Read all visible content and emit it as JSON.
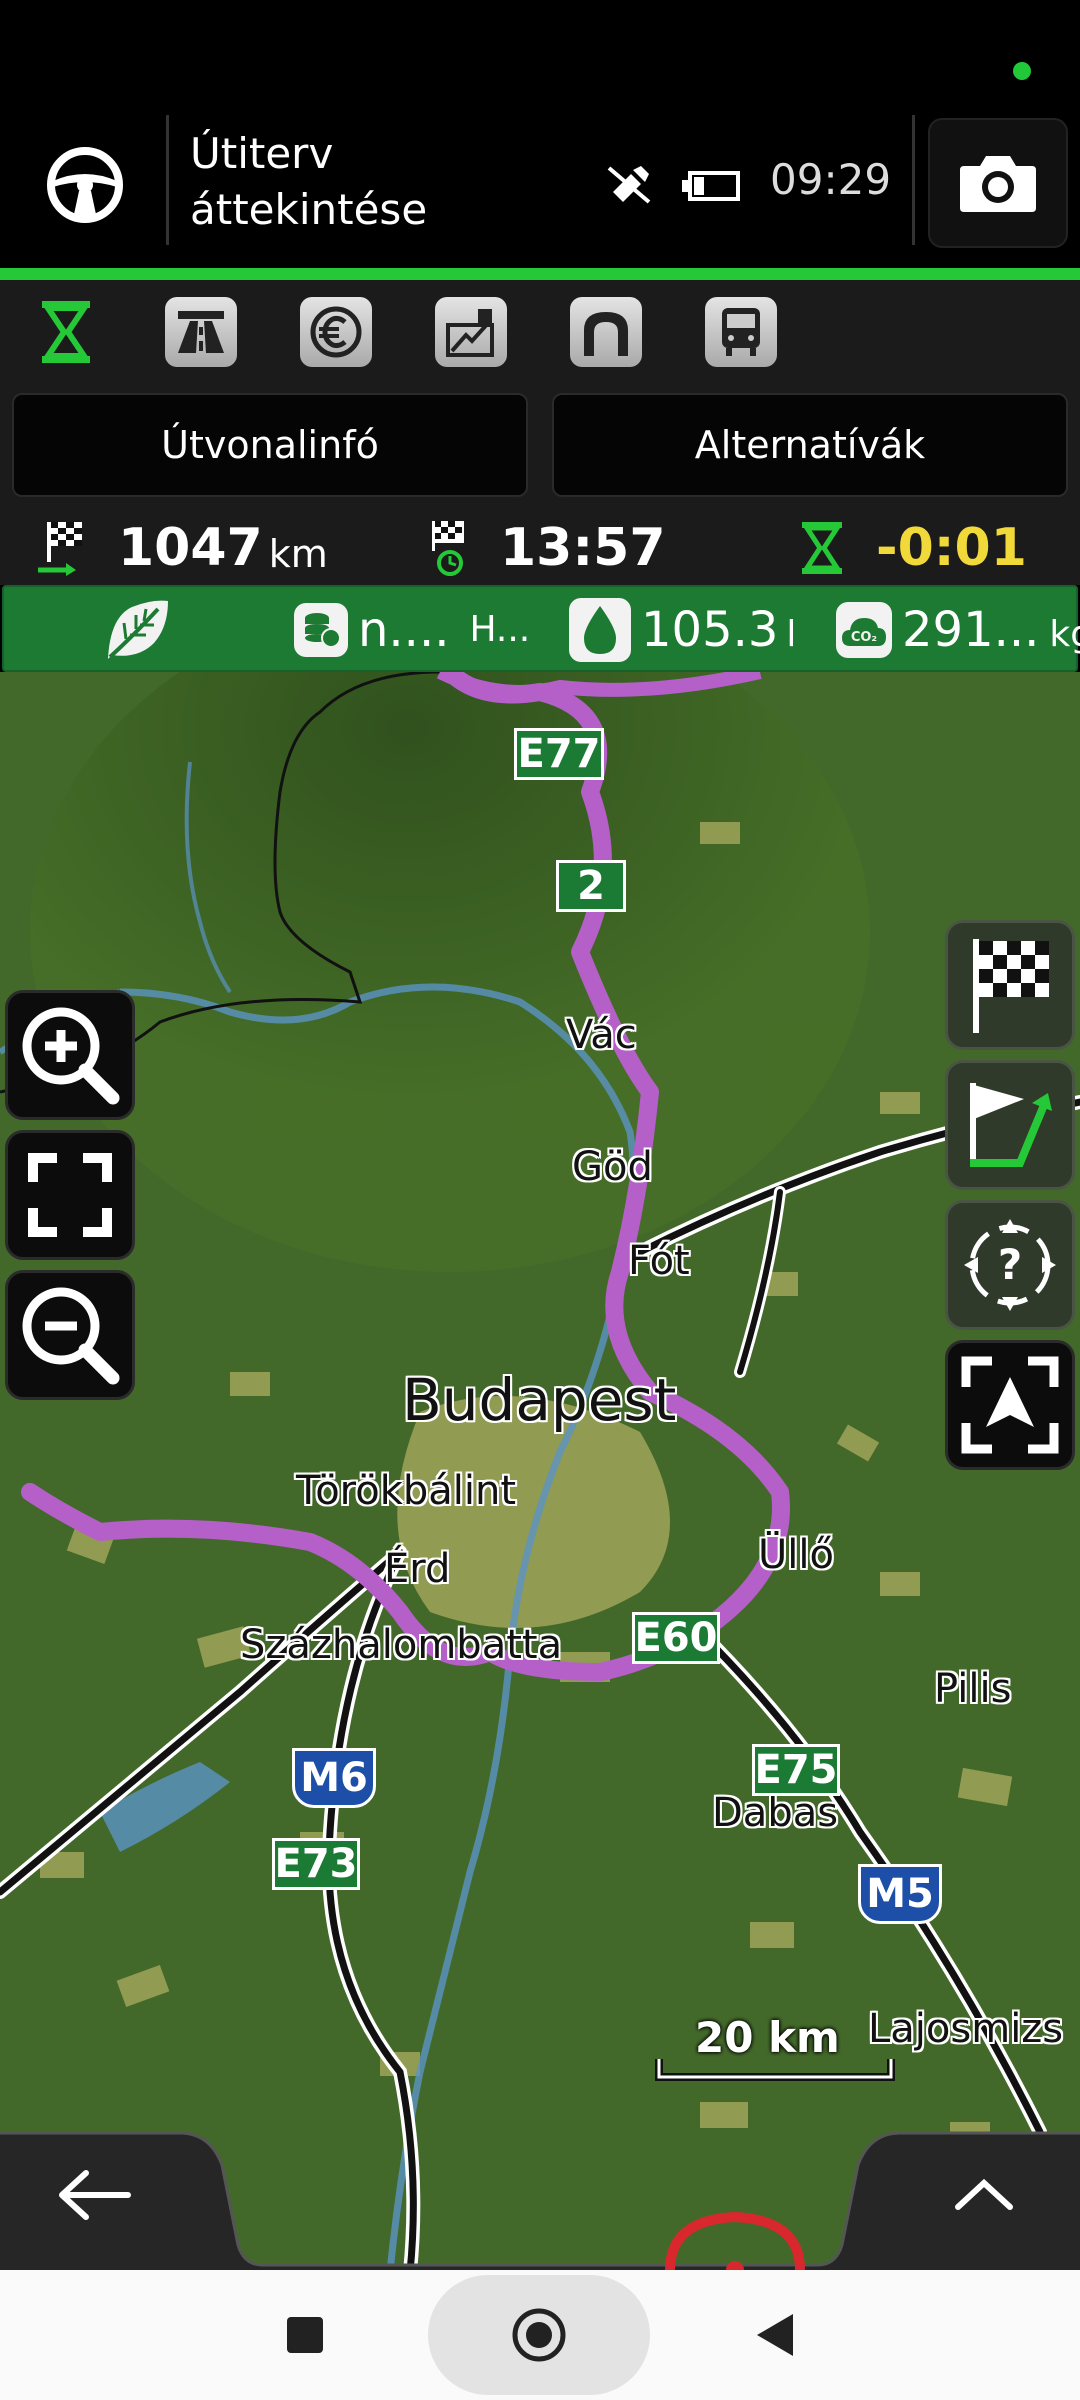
{
  "header": {
    "title_line1": "Útiterv",
    "title_line2": "áttekintése",
    "clock": "09:29"
  },
  "tabs": [
    {
      "label": "Útvonalinfó"
    },
    {
      "label": "Alternatívák"
    }
  ],
  "route_info": {
    "distance_value": "1047",
    "distance_unit": "km",
    "arrival_time": "13:57",
    "delay": "-0:01"
  },
  "eco": {
    "cost_value": "n....",
    "cost_currency": "H...",
    "fuel_value": "105.3",
    "fuel_unit": "l",
    "co2_value": "291...",
    "co2_unit": "kg",
    "co2_badge": "CO₂"
  },
  "map": {
    "cities": [
      {
        "name": "Vác"
      },
      {
        "name": "Göd"
      },
      {
        "name": "Fót"
      },
      {
        "name": "Budapest"
      },
      {
        "name": "Törökbálint"
      },
      {
        "name": "Érd"
      },
      {
        "name": "Üllő"
      },
      {
        "name": "Százhalombatta"
      },
      {
        "name": "Pilis"
      },
      {
        "name": "Dabas"
      },
      {
        "name": "Lajosmizs"
      }
    ],
    "shields": {
      "e77": "E77",
      "r2": "2",
      "e60": "E60",
      "e75": "E75",
      "m6": "M6",
      "e73": "E73",
      "m5": "M5"
    },
    "scale_label": "20 km"
  },
  "colors": {
    "accent_green": "#25c938",
    "route_purple": "#b460c8",
    "delay_yellow": "#f2d93a",
    "eco_green": "#1d7a33"
  }
}
